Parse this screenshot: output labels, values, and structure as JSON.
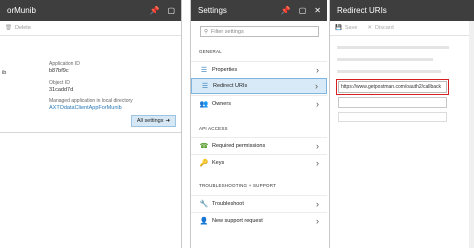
{
  "blade1": {
    "title": "orMunib",
    "cmd_delete": "Delete",
    "app_id_label": "Application ID",
    "app_id_value": "b87bf9c",
    "object_id_label": "Object ID",
    "object_id_value": "31cadd7d",
    "managed_label": "Managed application in local directory",
    "managed_value": "AXTOdataClientAppForMunib",
    "left_fragment": "ib",
    "all_settings": "All settings"
  },
  "blade2": {
    "title": "Settings",
    "filter_placeholder": "Filter settings",
    "section_general": "GENERAL",
    "properties": "Properties",
    "redirect_uris": "Redirect URIs",
    "owners": "Owners",
    "section_api": "API ACCESS",
    "required_permissions": "Required permissions",
    "keys": "Keys",
    "section_trouble": "TROUBLESHOOTING + SUPPORT",
    "troubleshoot": "Troubleshoot",
    "new_support": "New support request"
  },
  "blade3": {
    "title": "Redirect URIs",
    "save": "Save",
    "discard": "Discard",
    "uri_value": "https://www.getpostman.com/oauth2/callback"
  }
}
